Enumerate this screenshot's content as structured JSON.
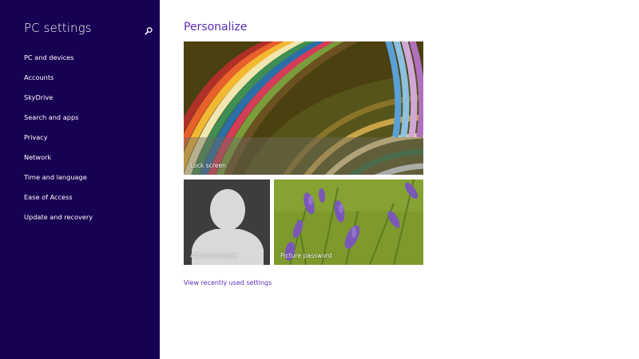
{
  "sidebar": {
    "title": "PC settings",
    "items": [
      {
        "label": "PC and devices"
      },
      {
        "label": "Accounts"
      },
      {
        "label": "SkyDrive"
      },
      {
        "label": "Search and apps"
      },
      {
        "label": "Privacy"
      },
      {
        "label": "Network"
      },
      {
        "label": "Time and language"
      },
      {
        "label": "Ease of Access"
      },
      {
        "label": "Update and recovery"
      }
    ]
  },
  "main": {
    "title": "Personalize",
    "tiles": {
      "lock_screen": "Lock screen",
      "account_picture": "Account picture",
      "picture_password": "Picture password"
    },
    "recent_link": "View recently used settings"
  },
  "colors": {
    "sidebar_bg": "#180052",
    "accent": "#5b2db4"
  },
  "icons": {
    "search": "search-icon"
  }
}
